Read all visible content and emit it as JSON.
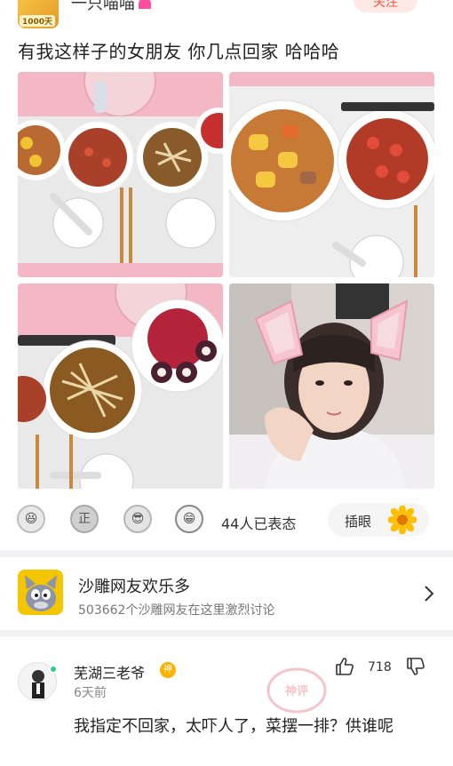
{
  "post": {
    "author": {
      "name": "一只喵喵",
      "badge": "1000天"
    },
    "follow_label": "关注",
    "title": "有我这样子的女朋友 你几点回家 哈哈哈"
  },
  "reactions": {
    "emoji_icons": [
      "laughing-face-icon",
      "zheng-face-icon",
      "sunglasses-face-icon",
      "grinning-face-icon"
    ],
    "emoji_glyphs": [
      "😆",
      "正",
      "😎",
      "😁"
    ],
    "count_text": "44人已表态",
    "insert_label": "插眼"
  },
  "group": {
    "name": "沙雕网友欢乐多",
    "desc": "503662个沙雕网友在这里激烈讨论"
  },
  "comment": {
    "author": "芜湖三老爷",
    "badge": "神",
    "time": "6天前",
    "likes": "718",
    "stamp": "神评",
    "text": "我指定不回家，太吓人了，菜摆一排？供谁呢"
  },
  "colors": {
    "accent": "#ff5a3c",
    "online": "#2bd18a",
    "badge": "#ffb100",
    "group_icon_bg": "#f3c600"
  }
}
